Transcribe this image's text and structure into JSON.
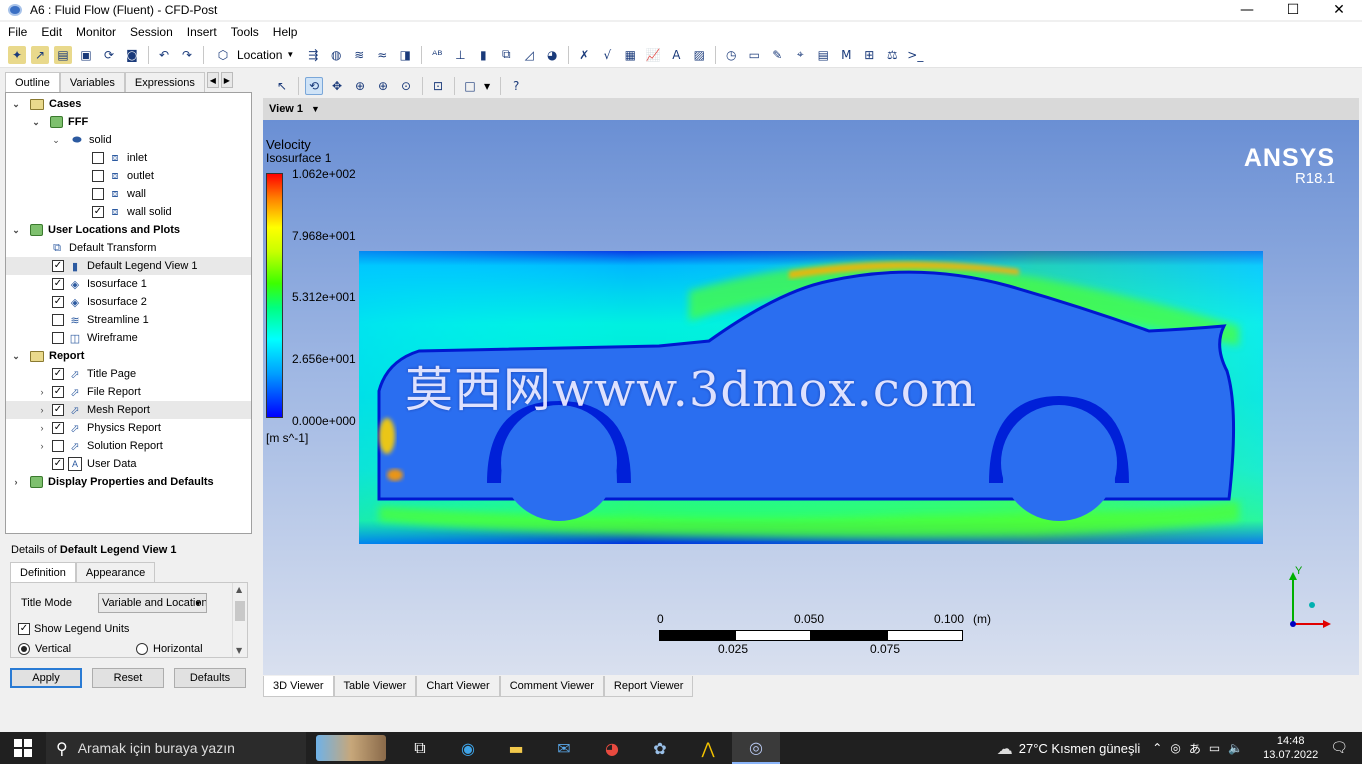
{
  "window": {
    "title": "A6 : Fluid Flow (Fluent) - CFD-Post"
  },
  "menu": [
    "File",
    "Edit",
    "Monitor",
    "Session",
    "Insert",
    "Tools",
    "Help"
  ],
  "toolbar": {
    "location_label": "Location"
  },
  "left_tabs": [
    "Outline",
    "Variables",
    "Expressions"
  ],
  "tree": {
    "cases": "Cases",
    "fff": "FFF",
    "solid": "solid",
    "inlet": "inlet",
    "outlet": "outlet",
    "wall": "wall",
    "wall_solid": "wall solid",
    "user_locations": "User Locations and Plots",
    "default_transform": "Default Transform",
    "default_legend": "Default Legend View 1",
    "isosurface1": "Isosurface 1",
    "isosurface2": "Isosurface 2",
    "streamline1": "Streamline 1",
    "wireframe": "Wireframe",
    "report": "Report",
    "title_page": "Title Page",
    "file_report": "File Report",
    "mesh_report": "Mesh Report",
    "physics_report": "Physics Report",
    "solution_report": "Solution Report",
    "user_data": "User Data",
    "display_props": "Display Properties and Defaults"
  },
  "details": {
    "title_prefix": "Details of",
    "title_object": "Default Legend View 1",
    "tabs": [
      "Definition",
      "Appearance"
    ],
    "title_mode_label": "Title Mode",
    "title_mode_value": "Variable and Location",
    "show_units_label": "Show Legend Units",
    "vertical_label": "Vertical",
    "horizontal_label": "Horizontal"
  },
  "buttons": {
    "apply": "Apply",
    "reset": "Reset",
    "defaults": "Defaults"
  },
  "view": {
    "name": "View 1"
  },
  "legend": {
    "variable": "Velocity",
    "location": "Isosurface 1",
    "ticks": [
      "1.062e+002",
      "7.968e+001",
      "5.312e+001",
      "2.656e+001",
      "0.000e+000"
    ],
    "units": "[m s^-1]"
  },
  "ansys": {
    "brand": "ANSYS",
    "version": "R18.1"
  },
  "watermark": "莫西网www.3dmox.com",
  "scale_bar": {
    "top": [
      "0",
      "0.050",
      "0.100",
      "(m)"
    ],
    "bottom": [
      "0.025",
      "0.075"
    ]
  },
  "axis_triad": {
    "y": "Y"
  },
  "viewer_tabs": [
    "3D Viewer",
    "Table Viewer",
    "Chart Viewer",
    "Comment Viewer",
    "Report Viewer"
  ],
  "taskbar": {
    "search_placeholder": "Aramak için buraya yazın",
    "weather": "27°C  Kısmen güneşli",
    "time": "14:48",
    "date": "13.07.2022"
  },
  "colors": {
    "accent": "#2a7bd4",
    "viewport_top": "#6a8fd4",
    "viewport_bottom": "#d9e0ef",
    "taskbar": "#202020"
  }
}
